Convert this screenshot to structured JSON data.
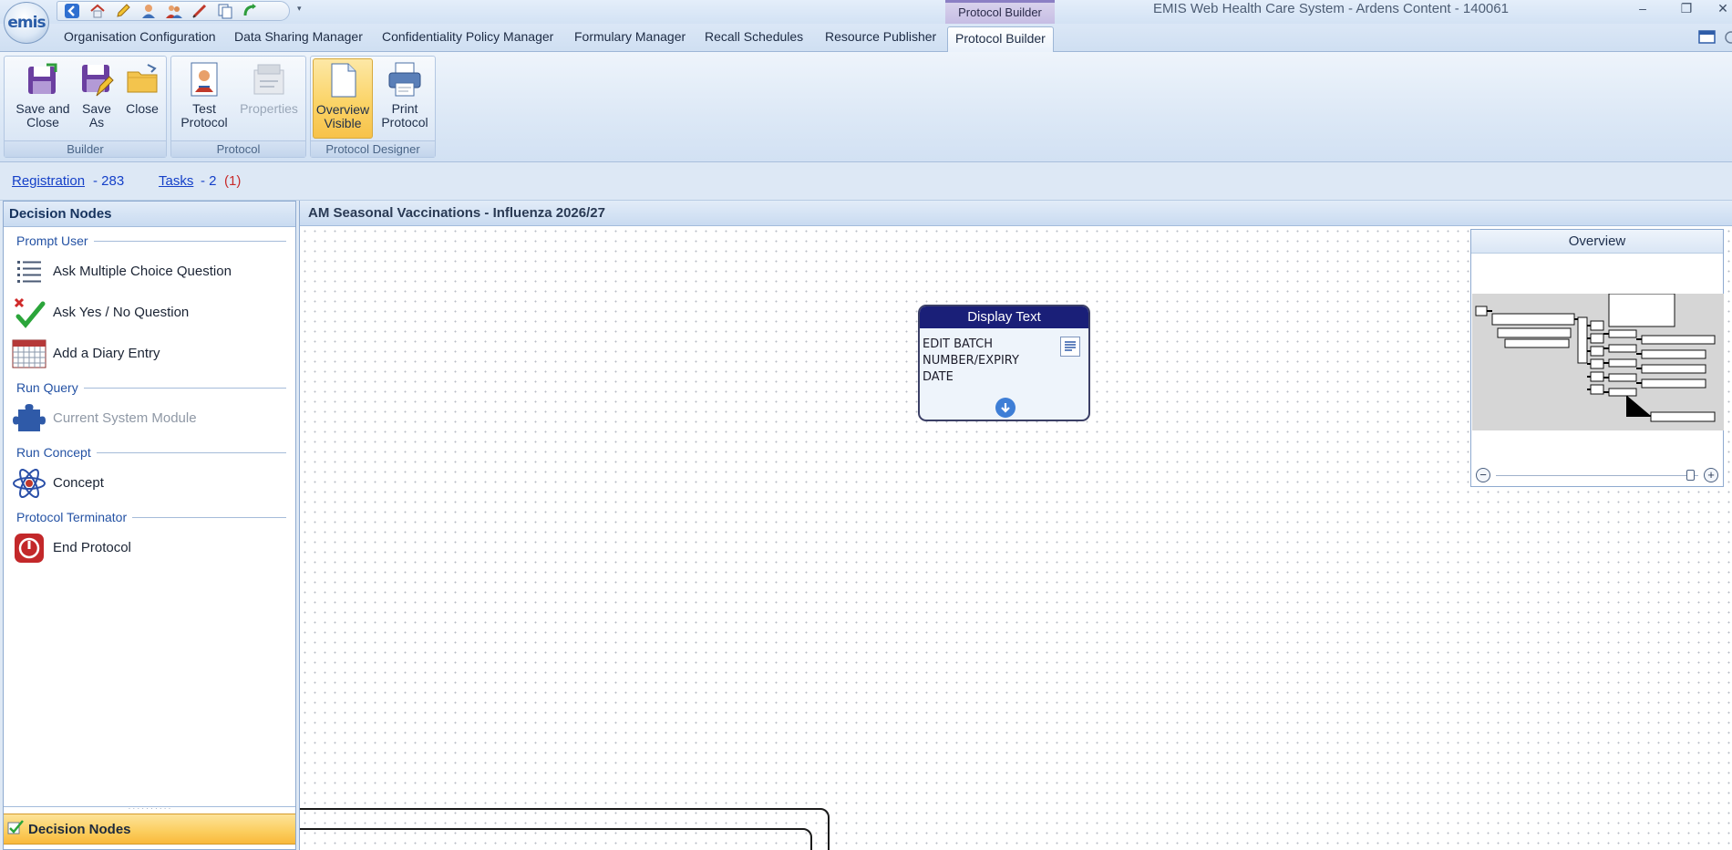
{
  "app": {
    "logo": "emis",
    "context_tab_group": "Protocol Builder",
    "window_title": "EMIS Web Health Care System - Ardens Content - 140061",
    "window_buttons": [
      "–",
      "❐",
      "✕"
    ]
  },
  "quick_access": [
    "back-icon",
    "home-icon",
    "edit-icon",
    "user-icon",
    "users-icon",
    "pen-icon",
    "copy-icon",
    "refresh-icon"
  ],
  "tabs": [
    {
      "label": "Organisation Configuration"
    },
    {
      "label": "Data Sharing Manager"
    },
    {
      "label": "Confidentiality Policy Manager"
    },
    {
      "label": "Formulary Manager"
    },
    {
      "label": "Recall Schedules"
    },
    {
      "label": "Resource Publisher"
    },
    {
      "label": "Protocol Builder",
      "active": true
    }
  ],
  "ribbon": {
    "groups": [
      {
        "label": "Builder",
        "buttons": [
          {
            "label": "Save and\nClose",
            "icon": "save-close-icon"
          },
          {
            "label": "Save\nAs",
            "icon": "save-as-icon"
          },
          {
            "label": "Close",
            "icon": "folder-close-icon"
          }
        ]
      },
      {
        "label": "Protocol",
        "buttons": [
          {
            "label": "Test\nProtocol",
            "icon": "test-protocol-icon"
          },
          {
            "label": "Properties",
            "icon": "properties-icon",
            "disabled": true
          }
        ]
      },
      {
        "label": "Protocol Designer",
        "buttons": [
          {
            "label": "Overview\nVisible",
            "icon": "overview-icon",
            "selected": true
          },
          {
            "label": "Print\nProtocol",
            "icon": "printer-icon"
          }
        ]
      }
    ]
  },
  "status": {
    "registration_label": "Registration",
    "registration_count": "- 283",
    "tasks_label": "Tasks",
    "tasks_count": "- 2",
    "tasks_urgent": "(1)"
  },
  "left_panel": {
    "title": "Decision Nodes",
    "sections": [
      {
        "heading": "Prompt User",
        "items": [
          {
            "label": "Ask Multiple Choice Question",
            "icon": "list-icon"
          },
          {
            "label": "Ask Yes / No Question",
            "icon": "check-cross-icon"
          },
          {
            "label": "Add a Diary Entry",
            "icon": "calendar-icon"
          }
        ]
      },
      {
        "heading": "Run Query",
        "items": [
          {
            "label": "Current System Module",
            "icon": "puzzle-icon",
            "disabled": true
          }
        ]
      },
      {
        "heading": "Run Concept",
        "items": [
          {
            "label": "Concept",
            "icon": "atom-icon"
          }
        ]
      },
      {
        "heading": "Protocol Terminator",
        "items": [
          {
            "label": "End Protocol",
            "icon": "power-icon"
          }
        ]
      }
    ],
    "nav_bar_label": "Decision Nodes"
  },
  "canvas": {
    "title": "AM Seasonal Vaccinations - Influenza 2026/27",
    "node": {
      "title": "Display Text",
      "lines": [
        "EDIT BATCH",
        "NUMBER/EXPIRY",
        "DATE"
      ]
    },
    "overview": {
      "title": "Overview",
      "zoom_out": "−",
      "zoom_in": "+"
    }
  },
  "colors": {
    "accent": "#1a1f78",
    "link": "#1540c8",
    "urgent": "#c82a2a",
    "selected": "#fbd468"
  }
}
